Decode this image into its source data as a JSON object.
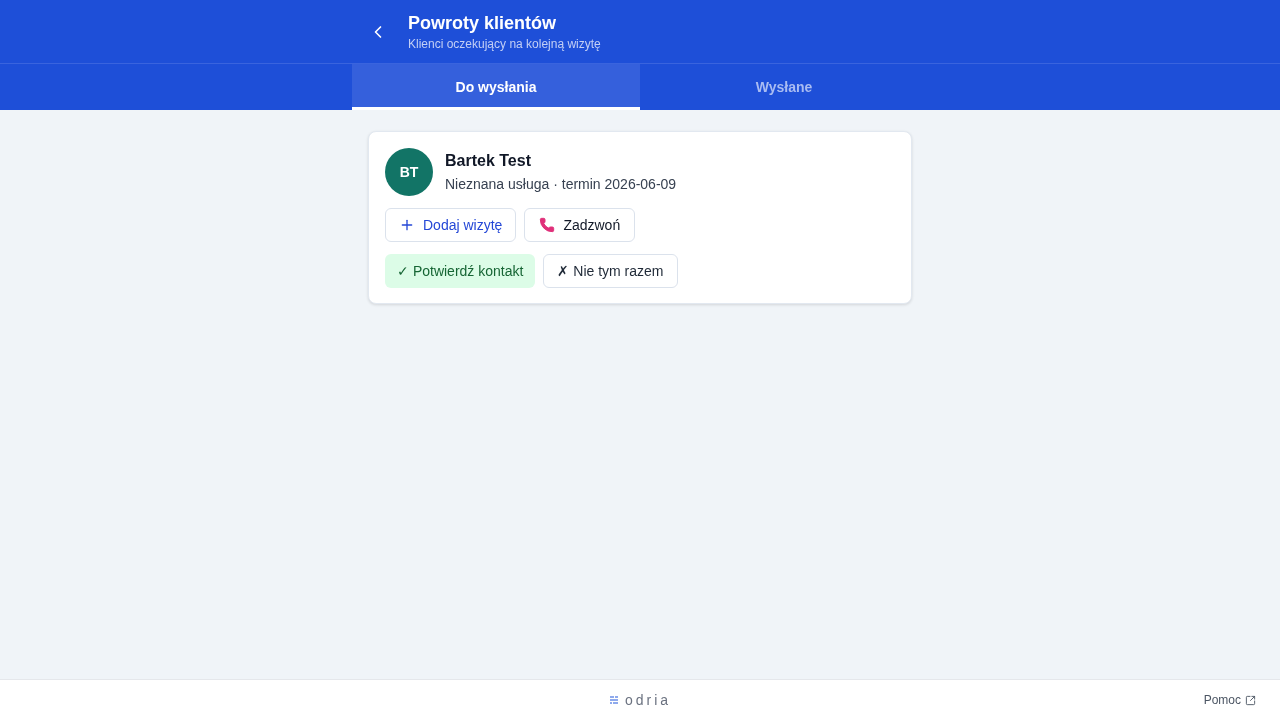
{
  "header": {
    "title": "Powroty klientów",
    "subtitle": "Klienci oczekujący na kolejną wizytę"
  },
  "tabs": [
    {
      "label": "Do wysłania",
      "selected": true
    },
    {
      "label": "Wysłane",
      "selected": false
    }
  ],
  "clients": [
    {
      "initials": "BT",
      "name": "Bartek Test",
      "details": "Nieznana usługa · termin 2026-06-09",
      "action_rows": [
        [
          {
            "kind": "add",
            "label": "Dodaj wizytę"
          },
          {
            "kind": "call",
            "label": "Zadzwoń"
          }
        ],
        [
          {
            "kind": "confirm",
            "label": "✓ Potwierdź kontakt"
          },
          {
            "kind": "dismiss",
            "label": "✗ Nie tym razem"
          }
        ]
      ]
    }
  ],
  "footer": {
    "logo": "odria",
    "help_link": "Pomoc"
  }
}
